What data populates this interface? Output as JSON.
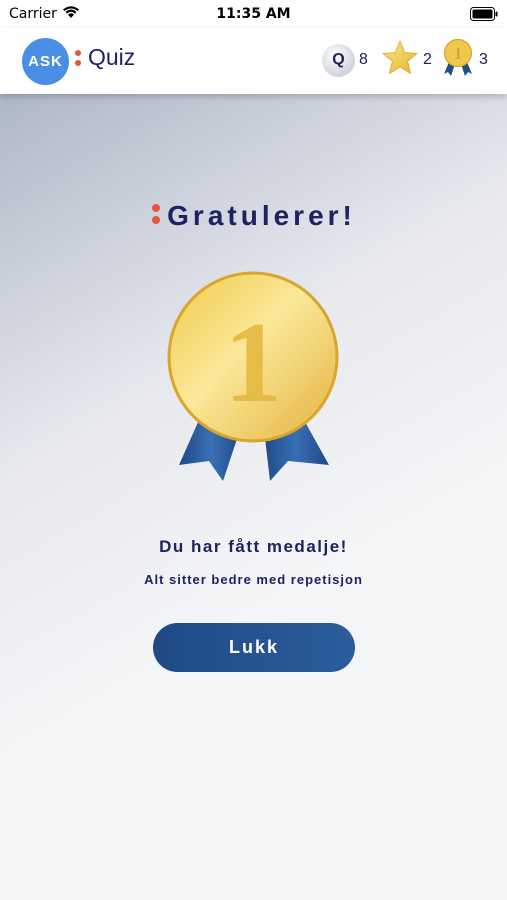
{
  "status_bar": {
    "carrier": "Carrier",
    "time": "11:35 AM"
  },
  "header": {
    "logo_text": "ASK",
    "title": "Quiz",
    "stats": {
      "quiz_label": "Q",
      "quiz_count": "8",
      "stars": "2",
      "medals": "3",
      "medal_number": "1"
    }
  },
  "main": {
    "heading": "Gratulerer!",
    "medal_number": "1",
    "subtitle": "Du har fått medalje!",
    "note": "Alt sitter bedre med repetisjon",
    "close_label": "Lukk"
  },
  "colors": {
    "accent_red": "#e8543f",
    "navy_text": "#1d2263",
    "button": "#1f4a86",
    "gold": "#e7bd3f",
    "ribbon": "#1f4e8c"
  },
  "icons": [
    "wifi-icon",
    "battery-icon",
    "quiz-badge-icon",
    "star-icon",
    "medal-icon"
  ]
}
